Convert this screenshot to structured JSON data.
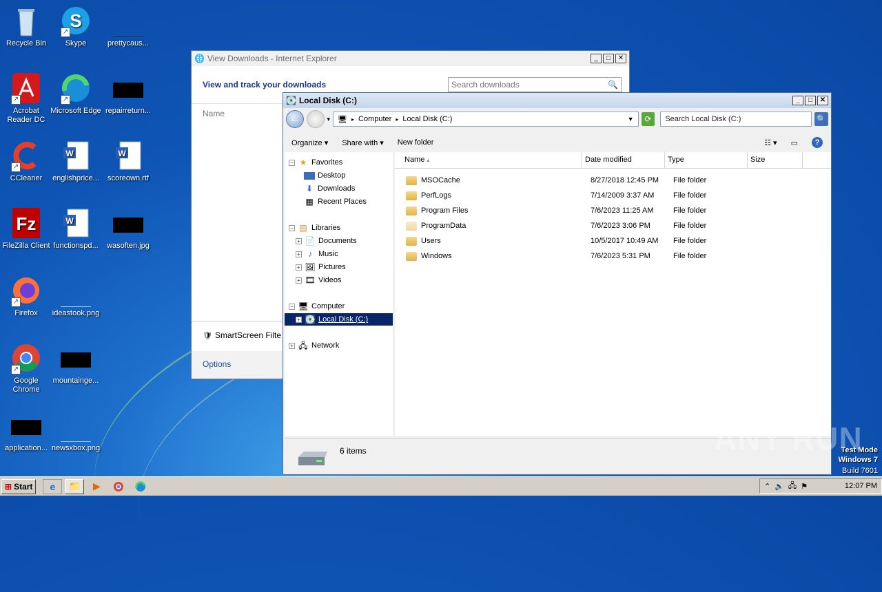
{
  "desktop": {
    "icons": [
      {
        "label": "Recycle Bin",
        "icon": "recycle-bin-icon"
      },
      {
        "label": "Skype",
        "icon": "skype-icon"
      },
      {
        "label": "prettycaus...",
        "icon": "file-icon"
      },
      {
        "label": "Acrobat Reader DC",
        "icon": "acrobat-icon"
      },
      {
        "label": "Microsoft Edge",
        "icon": "edge-icon"
      },
      {
        "label": "repairreturn...",
        "icon": "file-icon"
      },
      {
        "label": "CCleaner",
        "icon": "ccleaner-icon"
      },
      {
        "label": "englishprice...",
        "icon": "word-icon"
      },
      {
        "label": "scoreown.rtf",
        "icon": "word-icon"
      },
      {
        "label": "FileZilla Client",
        "icon": "filezilla-icon"
      },
      {
        "label": "functionspd...",
        "icon": "word-icon"
      },
      {
        "label": "wasoften.jpg",
        "icon": "image-icon"
      },
      {
        "label": "Firefox",
        "icon": "firefox-icon"
      },
      {
        "label": "ideastook.png",
        "icon": "image-icon"
      },
      {
        "label": "Google Chrome",
        "icon": "chrome-icon"
      },
      {
        "label": "mountainge...",
        "icon": "file-icon"
      },
      {
        "label": "application...",
        "icon": "file-icon"
      },
      {
        "label": "newsxbox.png",
        "icon": "image-icon"
      }
    ]
  },
  "ie_window": {
    "title": "View Downloads - Internet Explorer",
    "heading": "View and track your downloads",
    "search_placeholder": "Search downloads",
    "col_name": "Name",
    "smartscreen": "SmartScreen Filte",
    "options": "Options"
  },
  "explorer": {
    "title": "Local Disk (C:)",
    "breadcrumb": [
      "Computer",
      "Local Disk (C:)"
    ],
    "search_placeholder": "Search Local Disk (C:)",
    "toolbar": {
      "organize": "Organize",
      "share": "Share with",
      "new_folder": "New folder"
    },
    "nav": {
      "favorites": "Favorites",
      "desktop": "Desktop",
      "downloads": "Downloads",
      "recent": "Recent Places",
      "libraries": "Libraries",
      "documents": "Documents",
      "music": "Music",
      "pictures": "Pictures",
      "videos": "Videos",
      "computer": "Computer",
      "local_disk": "Local Disk (C:)",
      "network": "Network"
    },
    "columns": {
      "name": "Name",
      "date": "Date modified",
      "type": "Type",
      "size": "Size"
    },
    "files": [
      {
        "name": "MSOCache",
        "date": "8/27/2018 12:45 PM",
        "type": "File folder"
      },
      {
        "name": "PerfLogs",
        "date": "7/14/2009 3:37 AM",
        "type": "File folder"
      },
      {
        "name": "Program Files",
        "date": "7/6/2023 11:25 AM",
        "type": "File folder"
      },
      {
        "name": "ProgramData",
        "date": "7/6/2023 3:06 PM",
        "type": "File folder"
      },
      {
        "name": "Users",
        "date": "10/5/2017 10:49 AM",
        "type": "File folder"
      },
      {
        "name": "Windows",
        "date": "7/6/2023 5:31 PM",
        "type": "File folder"
      }
    ],
    "status": "6 items"
  },
  "taskbar": {
    "start": "Start",
    "clock": "12:07 PM"
  },
  "watermark": {
    "brand": "ANY RUN",
    "line1": "Test Mode",
    "line2": "Windows 7",
    "line3": "Build 7601"
  }
}
